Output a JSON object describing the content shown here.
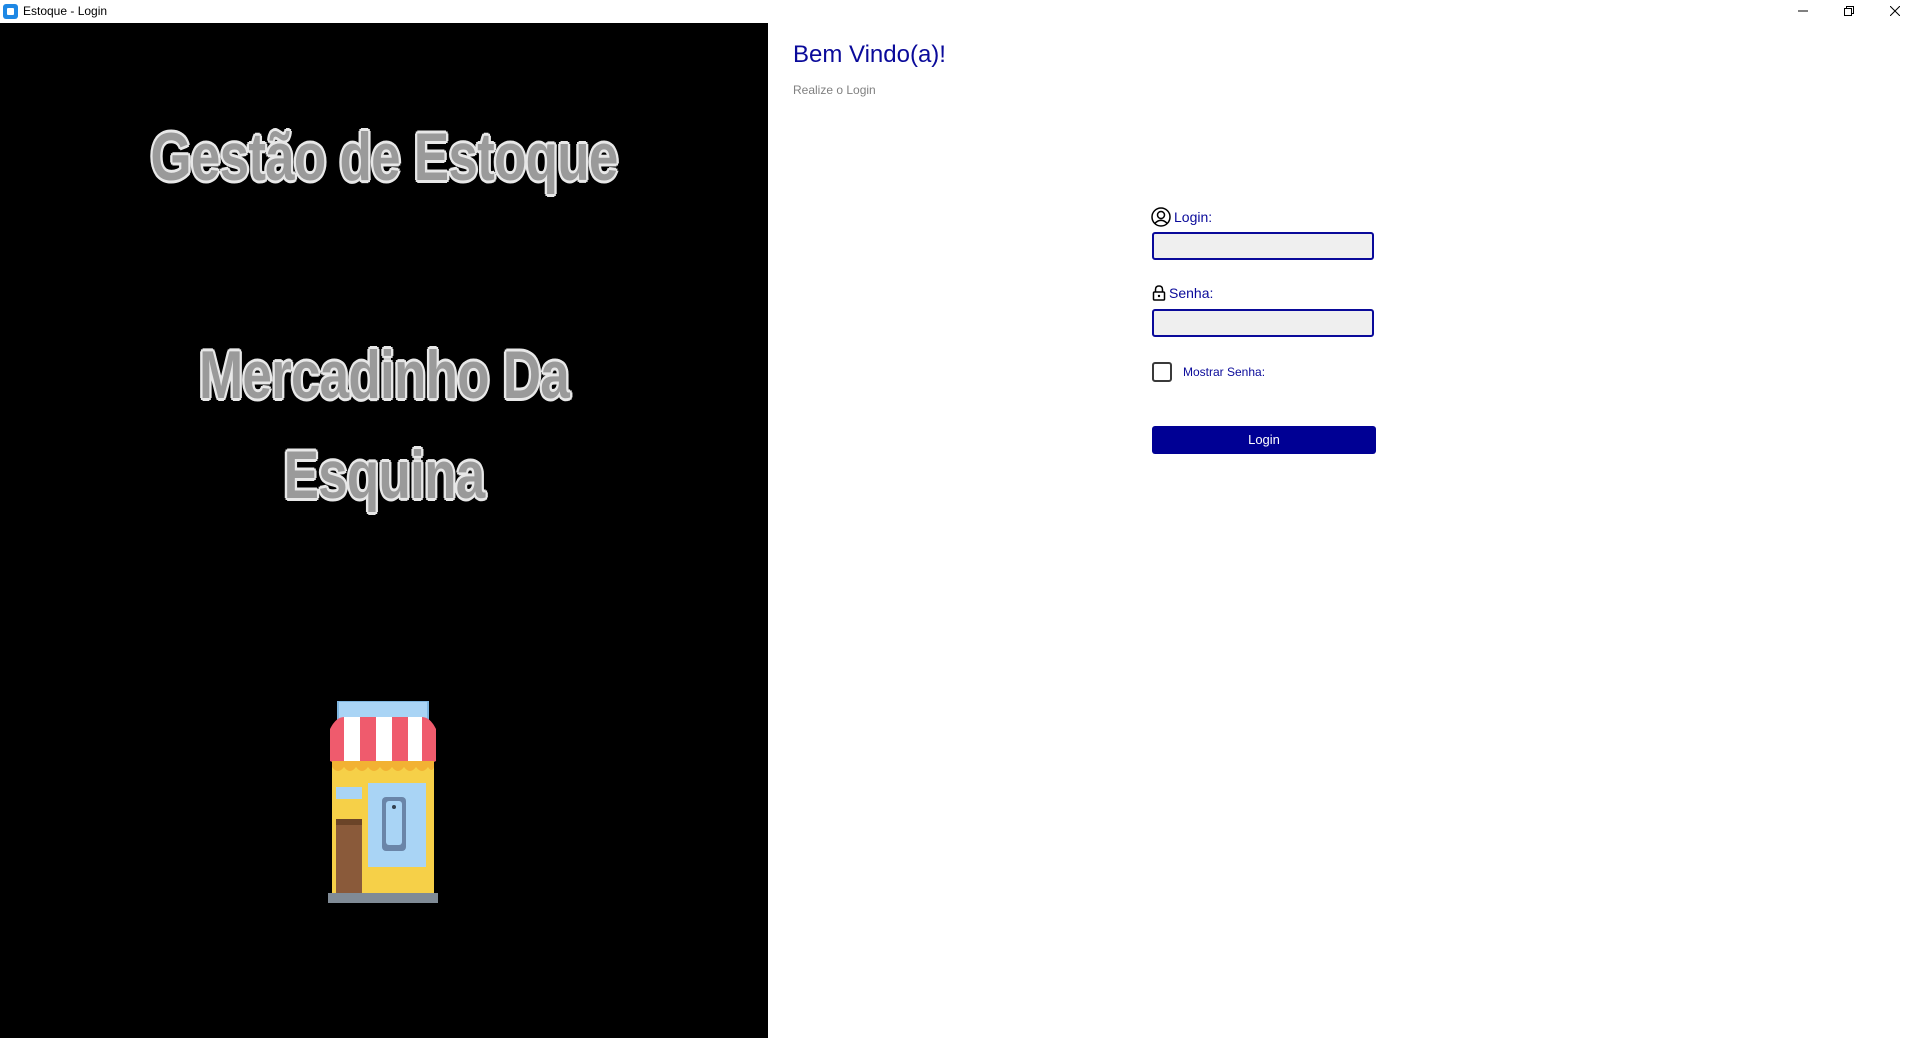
{
  "window": {
    "title": "Estoque - Login",
    "controls": [
      "minimize-icon",
      "restore-icon",
      "close-icon"
    ]
  },
  "left_panel": {
    "background": "#000000",
    "headline_line1": "Gestão de Estoque",
    "headline_line2": "Mercadinho Da",
    "headline_line3": "Esquina",
    "illustration": "store-icon"
  },
  "login_form": {
    "title": "Bem Vindo(a)!",
    "subtitle": "Realize o Login",
    "login_label": "Login:",
    "login_icon": "user-circle-icon",
    "login_value": "",
    "senha_label": "Senha:",
    "senha_icon": "lock-icon",
    "senha_value": "",
    "show_password_label": "Mostrar Senha:",
    "show_password_checked": false,
    "submit_label": "Login"
  },
  "colors": {
    "accent": "#0a0a9a",
    "button_bg": "#000094",
    "input_bg": "#efefef"
  }
}
